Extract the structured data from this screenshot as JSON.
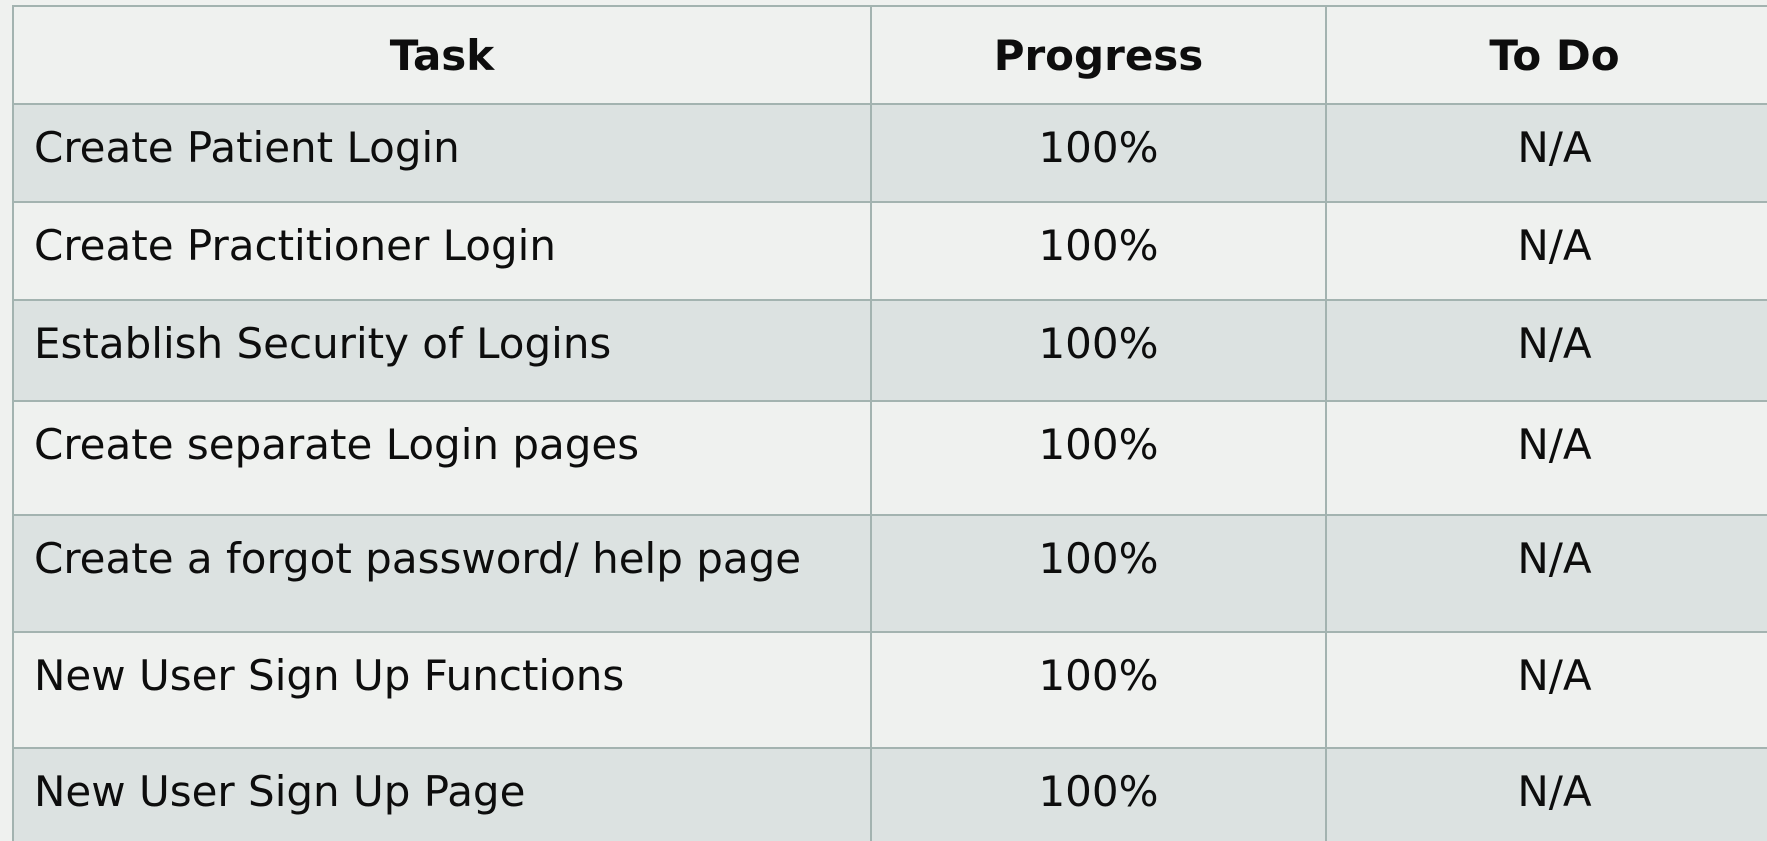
{
  "table": {
    "headers": {
      "task": "Task",
      "progress": "Progress",
      "todo": "To Do"
    },
    "rows": [
      {
        "task": "Create Patient Login",
        "progress": "100%",
        "todo": "N/A"
      },
      {
        "task": "Create Practitioner Login",
        "progress": "100%",
        "todo": "N/A"
      },
      {
        "task": "Establish Security of Logins",
        "progress": "100%",
        "todo": "N/A"
      },
      {
        "task": "Create separate Login pages",
        "progress": "100%",
        "todo": "N/A"
      },
      {
        "task": "Create a forgot password/ help page",
        "progress": "100%",
        "todo": "N/A"
      },
      {
        "task": "New User Sign Up Functions",
        "progress": "100%",
        "todo": "N/A"
      },
      {
        "task": "New User Sign Up Page",
        "progress": "100%",
        "todo": "N/A"
      }
    ]
  },
  "colors": {
    "background": "#eff1ef",
    "row_alt": "#dce2e1",
    "border": "#a3b3b0",
    "text": "#0d0d0d"
  }
}
